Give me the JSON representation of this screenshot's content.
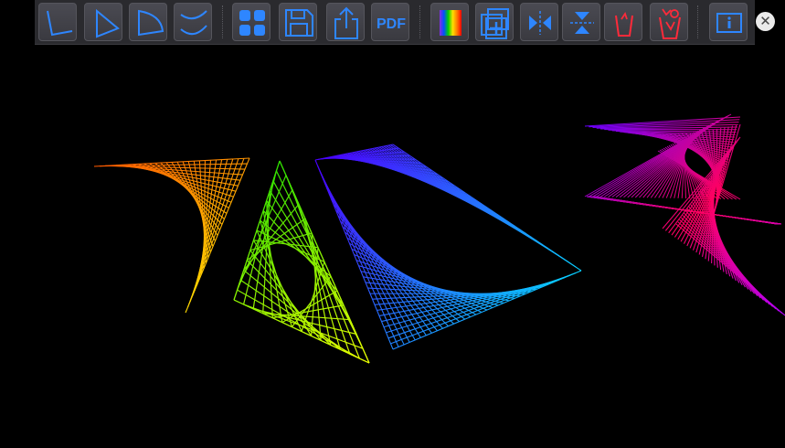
{
  "toolbar": {
    "buttons": [
      {
        "icon": "angle-icon",
        "enabled": true
      },
      {
        "icon": "triangle-icon",
        "enabled": true
      },
      {
        "icon": "sector-icon",
        "enabled": true
      },
      {
        "icon": "curves-icon",
        "enabled": true
      },
      {
        "icon": "grid-icon",
        "enabled": true
      },
      {
        "icon": "save-icon",
        "enabled": true
      },
      {
        "icon": "share-icon",
        "enabled": true
      },
      {
        "icon": "pdf-icon",
        "enabled": true
      },
      {
        "icon": "colors-icon",
        "enabled": true
      },
      {
        "icon": "duplicate-icon",
        "enabled": true
      },
      {
        "icon": "mirror-horizontal-icon",
        "enabled": true
      },
      {
        "icon": "mirror-vertical-icon",
        "enabled": true
      },
      {
        "icon": "delete-icon",
        "enabled": true
      },
      {
        "icon": "delete-all-icon",
        "enabled": true
      },
      {
        "icon": "info-icon",
        "enabled": true
      }
    ],
    "pdf_label": "PDF"
  },
  "close": {
    "label": "✕"
  },
  "colors": {
    "toolbar_bg": "#2a2a2e",
    "icon_blue": "#2e86ff",
    "icon_red": "#ff2a3a",
    "canvas_bg": "#000000"
  },
  "artwork": [
    {
      "shape": "angle",
      "gradient": [
        "#ff5a00",
        "#ffe000"
      ]
    },
    {
      "shape": "triangle",
      "gradient": [
        "#2ee000",
        "#e8ff00"
      ]
    },
    {
      "shape": "sector",
      "gradient": [
        "#4a00ff",
        "#00e6ff"
      ]
    },
    {
      "shape": "curves",
      "gradient": [
        "#6a00ff",
        "#ff0060"
      ]
    }
  ]
}
